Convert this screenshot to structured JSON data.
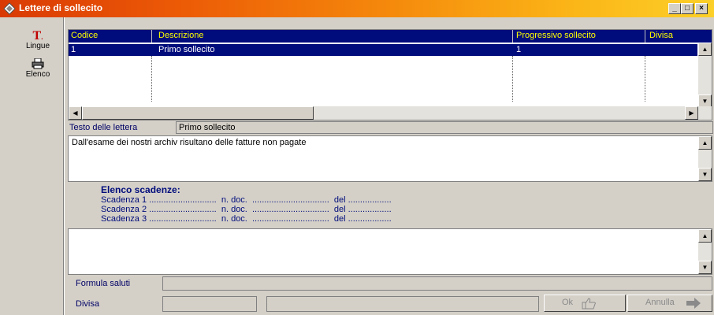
{
  "window": {
    "title": "Lettere di sollecito",
    "controls": {
      "minimize": "_",
      "maximize": "□",
      "close": "×"
    }
  },
  "toolbar": {
    "items": [
      {
        "label": "Lingue",
        "icon": "text-T-icon"
      },
      {
        "label": "Elenco",
        "icon": "printer-icon"
      }
    ]
  },
  "grid": {
    "columns": [
      "Codice",
      "Descrizione",
      "Progressivo sollecito",
      "Divisa"
    ],
    "rows": [
      {
        "codice": "1",
        "descrizione": "Primo sollecito",
        "progressivo": "1",
        "divisa": ""
      }
    ]
  },
  "testo": {
    "label": "Testo delle lettera",
    "value": "Primo sollecito"
  },
  "body_text": "Dall'esame dei nostri archiv risultano delle fatture non pagate",
  "scadenze": {
    "title": "Elenco scadenze:",
    "lines": [
      "Scadenza 1 ............................  n. doc.  ................................  del ..................",
      "Scadenza 2 ............................  n. doc.  ................................  del ..................",
      "Scadenza 3 ............................  n. doc.  ................................  del .................."
    ]
  },
  "formula": {
    "label": "Formula saluti",
    "value": ""
  },
  "divisa": {
    "label": "Divisa",
    "value": ""
  },
  "buttons": {
    "ok": "Ok",
    "annulla": "Annulla"
  },
  "colors": {
    "header_bg": "#000c7b",
    "header_text": "#ffff00",
    "title_gradient_start": "#d93a05",
    "title_gradient_end": "#fcd029"
  }
}
